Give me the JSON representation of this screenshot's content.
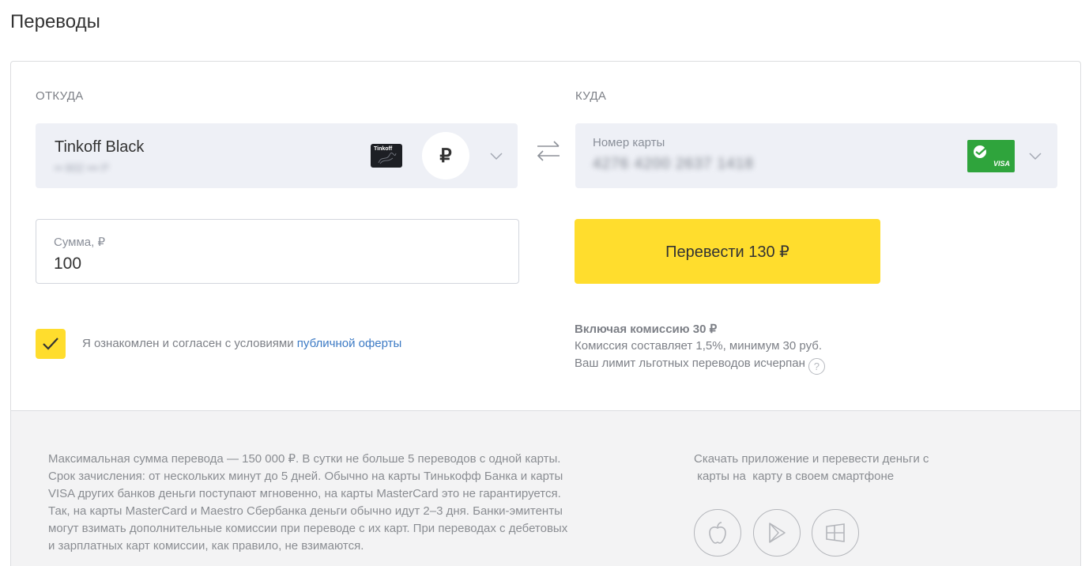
{
  "page": {
    "title": "Переводы"
  },
  "from": {
    "section_label": "ОТКУДА",
    "card_name": "Tinkoff Black",
    "card_number_masked": "•• 602 ••• Р",
    "card_thumb_brand": "Tinkoff",
    "currency_symbol": "₽"
  },
  "to": {
    "section_label": "КУДА",
    "field_label": "Номер карты",
    "card_number": "4276 4200 2637 1418",
    "card_brand": "VISA"
  },
  "amount": {
    "label": "Сумма, ₽",
    "value": "100"
  },
  "submit": {
    "label": "Перевести 130 ₽"
  },
  "agreement": {
    "checked": true,
    "text": "Я ознакомлен и согласен с условиями ",
    "link_text": "публичной оферты"
  },
  "fees": {
    "title": "Включая комиссию 30 ₽",
    "line1": "Комиссия составляет 1,5%, минимум 30 руб.",
    "line2": "Ваш лимит льготных переводов исчерпан",
    "help": "?"
  },
  "footer": {
    "info_lines": [
      "Максимальная сумма перевода — 150 000 ₽. В сутки не больше 5 переводов с одной карты.",
      "Срок зачисления: от нескольких минут до 5 дней. Обычно на карты Тинькофф Банка и карты",
      "VISA других банков деньги поступают мгновенно, на карты MasterCard это не гарантируется.",
      "Так, на карты MasterCard и Maestro Сбербанка деньги обычно идут 2–3 дня. Банки-эмитенты",
      "могут взимать дополнительные комиссии при переводе с их карт. При переводах с дебетовых",
      "и зарплатных карт комиссии, как правило, не взимаются."
    ],
    "app_lines": [
      "Скачать приложение и  перевести деньги с",
      " карты на  карту в своем смартфоне"
    ],
    "stores": [
      "apple-icon",
      "google-play-icon",
      "windows-icon"
    ]
  },
  "colors": {
    "accent_yellow": "#ffdd2d",
    "card_bg": "#eef0f6",
    "link": "#3c7ac4",
    "sber_green": "#2fa43c"
  }
}
